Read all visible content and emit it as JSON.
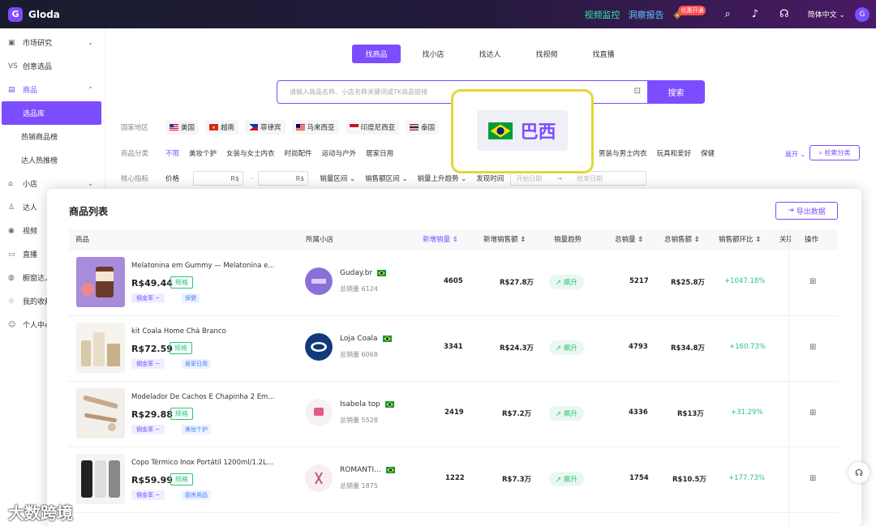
{
  "header": {
    "logo": "Gloda",
    "logo_mark": "G",
    "link_video_monitor": "视频监控",
    "link_insight_report": "洞察报告",
    "promo_badge": "优惠开通",
    "language": "简体中文",
    "avatar": "G"
  },
  "sidebar": {
    "items": [
      {
        "label": "市场研究",
        "icon": "chart-icon"
      },
      {
        "label": "创意选品",
        "icon": "vs-icon"
      },
      {
        "label": "商品",
        "icon": "product-icon"
      },
      {
        "label": "选品库"
      },
      {
        "label": "热销商品榜"
      },
      {
        "label": "达人热推榜"
      },
      {
        "label": "小店",
        "icon": "shop-icon"
      },
      {
        "label": "达人",
        "icon": "user-icon"
      },
      {
        "label": "视频",
        "icon": "video-icon"
      },
      {
        "label": "直播",
        "icon": "live-icon"
      },
      {
        "label": "橱窗达人",
        "icon": "showcase-icon"
      },
      {
        "label": "我的收藏",
        "icon": "star-icon"
      },
      {
        "label": "个人中心",
        "icon": "face-icon"
      }
    ]
  },
  "search": {
    "tabs": [
      "找商品",
      "找小店",
      "找达人",
      "找视频",
      "找直播"
    ],
    "placeholder": "请输入商品名称、小店名称关键词或TK商品链接",
    "button": "搜索"
  },
  "filters": {
    "country_label": "国家地区",
    "countries": [
      "美国",
      "越南",
      "菲律宾",
      "马来西亚",
      "印度尼西亚",
      "泰国"
    ],
    "category_label": "商品分类",
    "categories": [
      "不限",
      "美妆个护",
      "女装与女士内衣",
      "时尚配件",
      "运动与户外",
      "居家日用"
    ],
    "categories_right": [
      "男装与男士内衣",
      "玩具和爱好",
      "保健"
    ],
    "expand": "展开",
    "search_category": "检索分类",
    "metrics_label": "核心指标",
    "price_label": "价格",
    "currency": "R$",
    "sales_range": "销量区间",
    "revenue_range": "销售额区间",
    "sales_trend": "销量上升趋势",
    "discover_time": "发现时间",
    "start_date": "开始日期",
    "end_date": "结束日期"
  },
  "highlight": {
    "label": "巴西"
  },
  "product_list": {
    "title": "商品列表",
    "export": "导出数据",
    "columns": [
      "商品",
      "所属小店",
      "新增销量",
      "新增销售额",
      "销量趋势",
      "总销量",
      "总销售额",
      "销售额环比",
      "关联",
      "操作"
    ],
    "commission_label": "佣金率 ~",
    "spec_label": "规格",
    "sales_prefix": "总销量",
    "rows": [
      {
        "name": "Melatonina em Gummy — Melatonina e...",
        "price": "R$49.44",
        "tag": "保健",
        "shop": "Guday.br",
        "shop_sales": "6124",
        "new_sales": "4605",
        "new_revenue": "R$27.8万",
        "trend": "飙升",
        "total_sales": "5217",
        "total_revenue": "R$25.8万",
        "ring": "+1047.18%"
      },
      {
        "name": "kit Coala Home Chá Branco",
        "price": "R$72.59",
        "tag": "居家日用",
        "shop": "Loja Coala",
        "shop_sales": "6068",
        "new_sales": "3341",
        "new_revenue": "R$24.3万",
        "trend": "飙升",
        "total_sales": "4793",
        "total_revenue": "R$34.8万",
        "ring": "+160.73%"
      },
      {
        "name": "Modelador De Cachos E Chapinha 2 Em...",
        "price": "R$29.88",
        "tag": "美妆个护",
        "shop": "Isabela top",
        "shop_sales": "5528",
        "new_sales": "2419",
        "new_revenue": "R$7.2万",
        "trend": "飙升",
        "total_sales": "4336",
        "total_revenue": "R$13万",
        "ring": "+31.29%"
      },
      {
        "name": "Copo Térmico Inox Portátil 1200ml/1.2L...",
        "price": "R$59.99",
        "tag": "厨房用品",
        "shop": "ROMANTI...",
        "shop_sales": "1875",
        "new_sales": "1222",
        "new_revenue": "R$7.3万",
        "trend": "飙升",
        "total_sales": "1754",
        "total_revenue": "R$10.5万",
        "ring": "+177.73%"
      }
    ]
  },
  "watermark": "大数跨境"
}
